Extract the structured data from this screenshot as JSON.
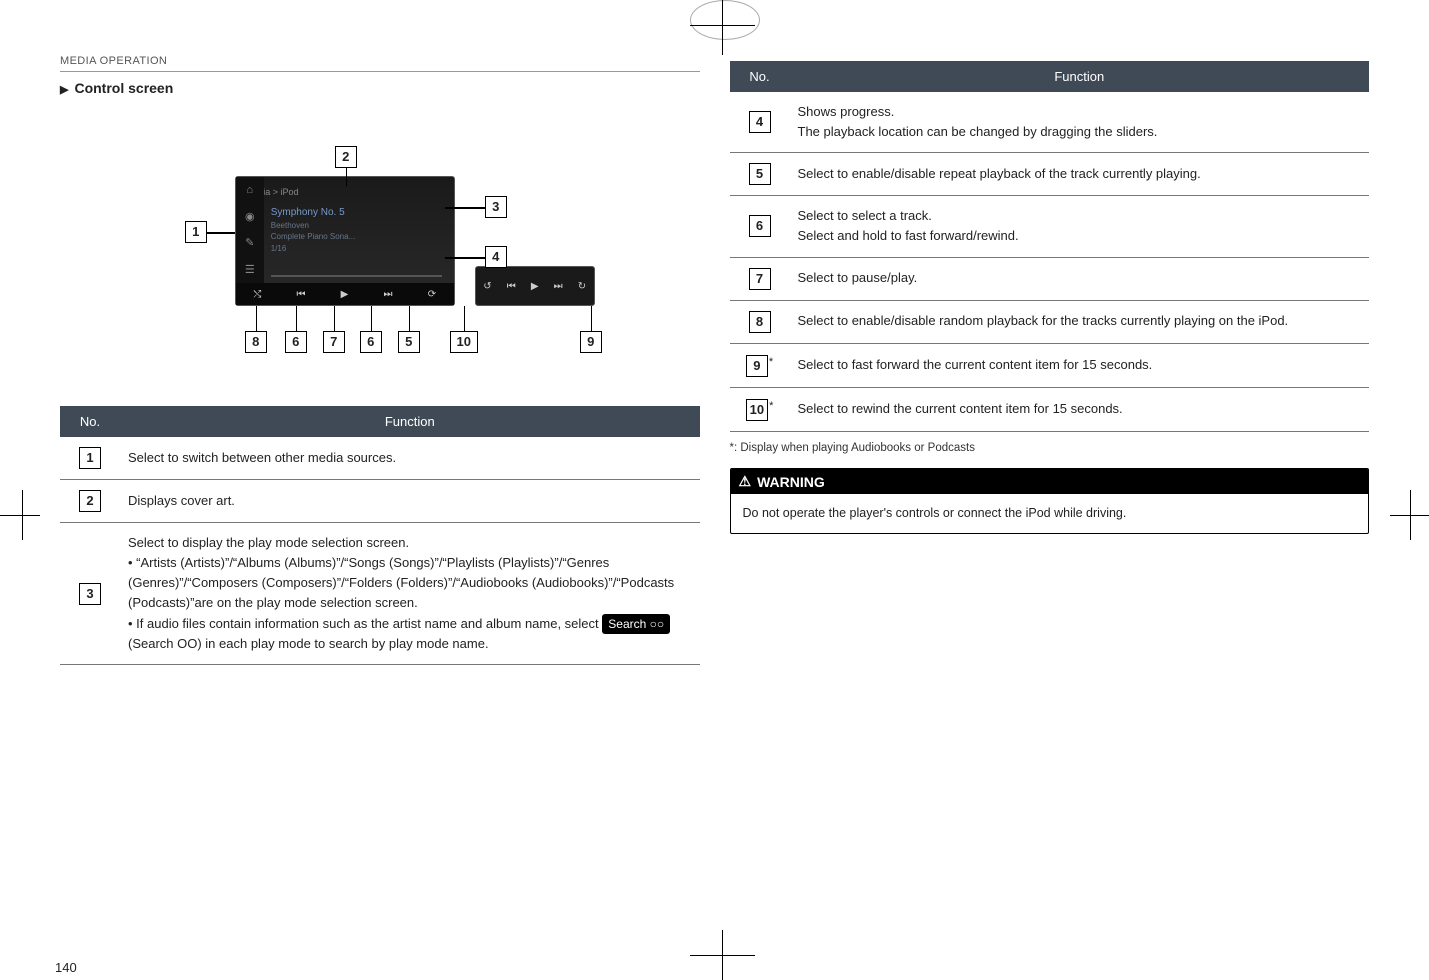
{
  "sectionLabel": "MEDIA OPERATION",
  "subheading": "Control screen",
  "pageNumber": "140",
  "diagram": {
    "numbers": [
      "1",
      "2",
      "3",
      "4",
      "5",
      "6",
      "7",
      "8",
      "9",
      "10"
    ]
  },
  "tableHeaders": {
    "no": "No.",
    "function": "Function"
  },
  "leftTable": [
    {
      "num": "1",
      "text": "Select to switch between other media sources."
    },
    {
      "num": "2",
      "text": "Displays cover art."
    },
    {
      "num": "3",
      "text": "Select to display the play mode selection screen.",
      "bullets": [
        "“Artists (Artists)”/“Albums (Albums)”/“Songs (Songs)”/“Playlists (Playlists)”/“Genres (Genres)”/“Composers (Composers)”/“Folders (Folders)”/“Audiobooks (Audiobooks)”/“Podcasts (Podcasts)”are on the play mode selection screen.",
        "If audio files contain information such as the artist name and album name, select {{PILL}} (Search OO) in each play mode to search by play mode name."
      ],
      "pillLabel": "Search ○○"
    }
  ],
  "rightTable": [
    {
      "num": "4",
      "text": "Shows progress.\nThe playback location can be changed by dragging the sliders."
    },
    {
      "num": "5",
      "text": "Select to enable/disable repeat playback of the track currently playing."
    },
    {
      "num": "6",
      "text": "Select to select a track.\nSelect and hold to fast forward/rewind."
    },
    {
      "num": "7",
      "text": "Select to pause/play."
    },
    {
      "num": "8",
      "text": "Select to enable/disable random playback for the tracks currently playing on the iPod."
    },
    {
      "num": "9",
      "star": "*",
      "text": "Select to fast forward the current content item for 15 seconds."
    },
    {
      "num": "10",
      "star": "*",
      "text": "Select to rewind the current content item for 15 seconds."
    }
  ],
  "footnote": "*: Display when playing Audiobooks or Podcasts",
  "warning": {
    "title": "WARNING",
    "icon": "⚠",
    "body": "Do not operate the player's controls or connect the iPod while driving."
  }
}
